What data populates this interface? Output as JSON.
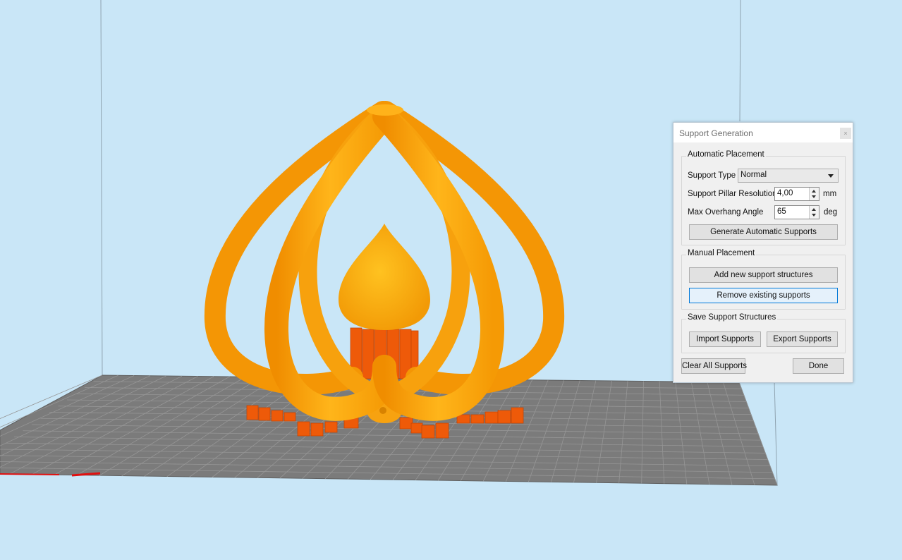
{
  "dialog": {
    "title": "Support Generation",
    "close_label": "×",
    "automatic": {
      "group_title": "Automatic Placement",
      "support_type_label": "Support Type",
      "support_type_value": "Normal",
      "pillar_resolution_label": "Support Pillar Resolution",
      "pillar_resolution_value": "4,00",
      "pillar_resolution_unit": "mm",
      "overhang_label": "Max Overhang Angle",
      "overhang_value": "65",
      "overhang_unit": "deg",
      "generate_label": "Generate Automatic Supports"
    },
    "manual": {
      "group_title": "Manual Placement",
      "add_label": "Add new support structures",
      "remove_label": "Remove existing supports"
    },
    "save": {
      "group_title": "Save Support Structures",
      "import_label": "Import Supports",
      "export_label": "Export Supports"
    },
    "clear_label": "Clear All Supports",
    "done_label": "Done"
  },
  "colors": {
    "sky": "#c9e6f7",
    "bed": "#7a7a7a",
    "model": "#ffa912",
    "supports": "#f05a0a"
  }
}
